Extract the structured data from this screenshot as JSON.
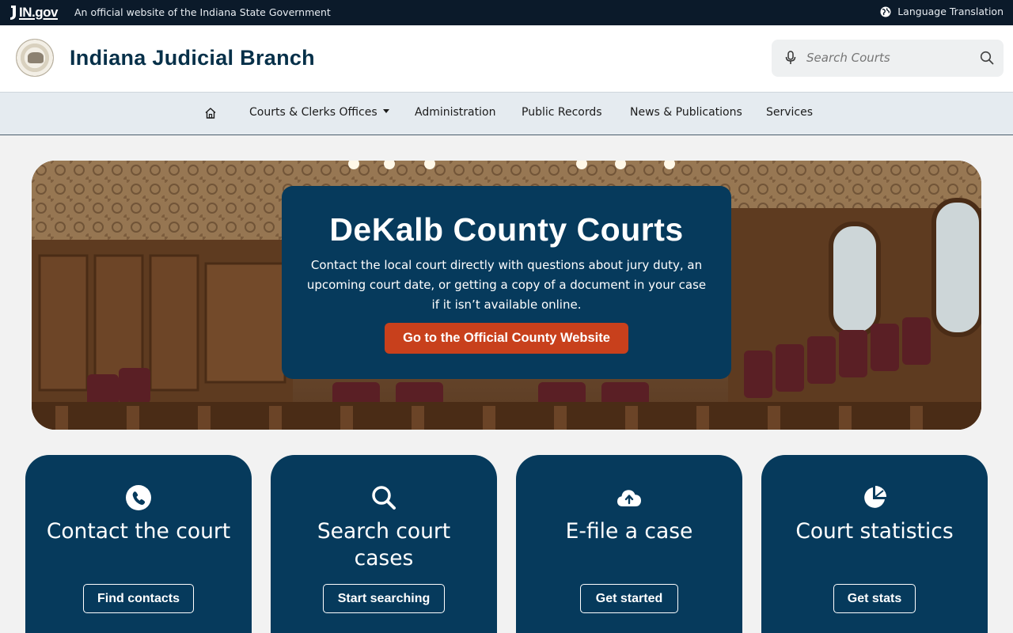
{
  "govbar": {
    "logo_text": "IN.gov",
    "official_text": "An official website of the Indiana State Government",
    "language_label": "Language Translation"
  },
  "header": {
    "site_title": "Indiana Judicial Branch",
    "search_placeholder": "Search Courts"
  },
  "nav": {
    "items": [
      {
        "label": "Courts & Clerks Offices",
        "has_dropdown": true
      },
      {
        "label": "Administration"
      },
      {
        "label": "Public Records"
      },
      {
        "label": "News & Publications"
      },
      {
        "label": "Services"
      }
    ]
  },
  "hero": {
    "title": "DeKalb County Courts",
    "description": "Contact the local court directly with questions about jury duty, an upcoming court date, or getting a copy of a document in your case if it isn’t available online.",
    "button_label": "Go to the Official County Website"
  },
  "cards": [
    {
      "title": "Contact the court",
      "button": "Find contacts",
      "icon": "phone-icon"
    },
    {
      "title": "Search court cases",
      "button": "Start searching",
      "icon": "search-icon"
    },
    {
      "title": "E-file a case",
      "button": "Get started",
      "icon": "cloud-upload-icon"
    },
    {
      "title": "Court statistics",
      "button": "Get stats",
      "icon": "pie-chart-icon"
    }
  ],
  "colors": {
    "navy": "#063a5c",
    "govbar": "#0b1a2a",
    "accent_button": "#c8401c",
    "nav_bg": "#e5ebf0"
  }
}
